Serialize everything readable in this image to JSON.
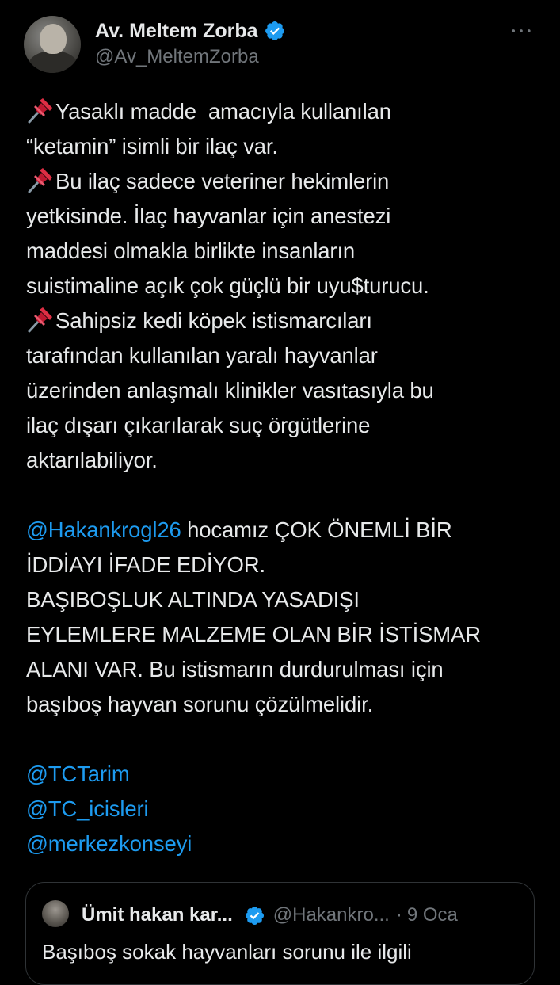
{
  "author": {
    "display_name": "Av. Meltem Zorba",
    "handle": "@Av_MeltemZorba"
  },
  "menu": {
    "more_label": "•••"
  },
  "tweet": {
    "lines": [
      {
        "pin": true,
        "text": "Yasaklı madde  amacıyla kullanılan"
      },
      {
        "pin": false,
        "text": "“ketamin” isimli bir ilaç var."
      },
      {
        "pin": true,
        "text": "Bu ilaç sadece veteriner hekimlerin"
      },
      {
        "pin": false,
        "text": "yetkisinde. İlaç hayvanlar için anestezi"
      },
      {
        "pin": false,
        "text": "maddesi olmakla birlikte insanların"
      },
      {
        "pin": false,
        "text": "suistimaline açık çok güçlü bir uyu$turucu."
      },
      {
        "pin": true,
        "text": "Sahipsiz kedi köpek istismarcıları"
      },
      {
        "pin": false,
        "text": "tarafından kullanılan yaralı hayvanlar"
      },
      {
        "pin": false,
        "text": "üzerinden anlaşmalı klinikler vasıtasıyla bu"
      },
      {
        "pin": false,
        "text": "ilaç dışarı çıkarılarak suç örgütlerine"
      },
      {
        "pin": false,
        "text": "aktarılabiliyor."
      }
    ],
    "mention_main": "@Hakankrogl26",
    "mention_main_suffix": " hocamız ÇOK ÖNEMLİ BİR",
    "claim_lines": [
      "İDDİAYI İFADE EDİYOR.",
      "BAŞIBOŞLUK ALTINDA YASADIŞI",
      "EYLEMLERE MALZEME OLAN BİR İSTİSMAR",
      "ALANI VAR. Bu istismarın durdurulması için",
      "başıboş hayvan sorunu çözülmelidir."
    ],
    "tagged": [
      "@TCTarim",
      "@TC_icisleri",
      "@merkezkonseyi"
    ]
  },
  "quote": {
    "display_name": "Ümit hakan kar...",
    "handle": "@Hakankro...",
    "separator": "·",
    "date": "9 Oca",
    "text_preview": "Başıboş sokak hayvanları sorunu ile ilgili"
  },
  "colors": {
    "background": "#000000",
    "text": "#e7e9ea",
    "muted": "#71767b",
    "link": "#1d9bf0",
    "verified": "#1d9bf0",
    "border": "#2f3336"
  }
}
